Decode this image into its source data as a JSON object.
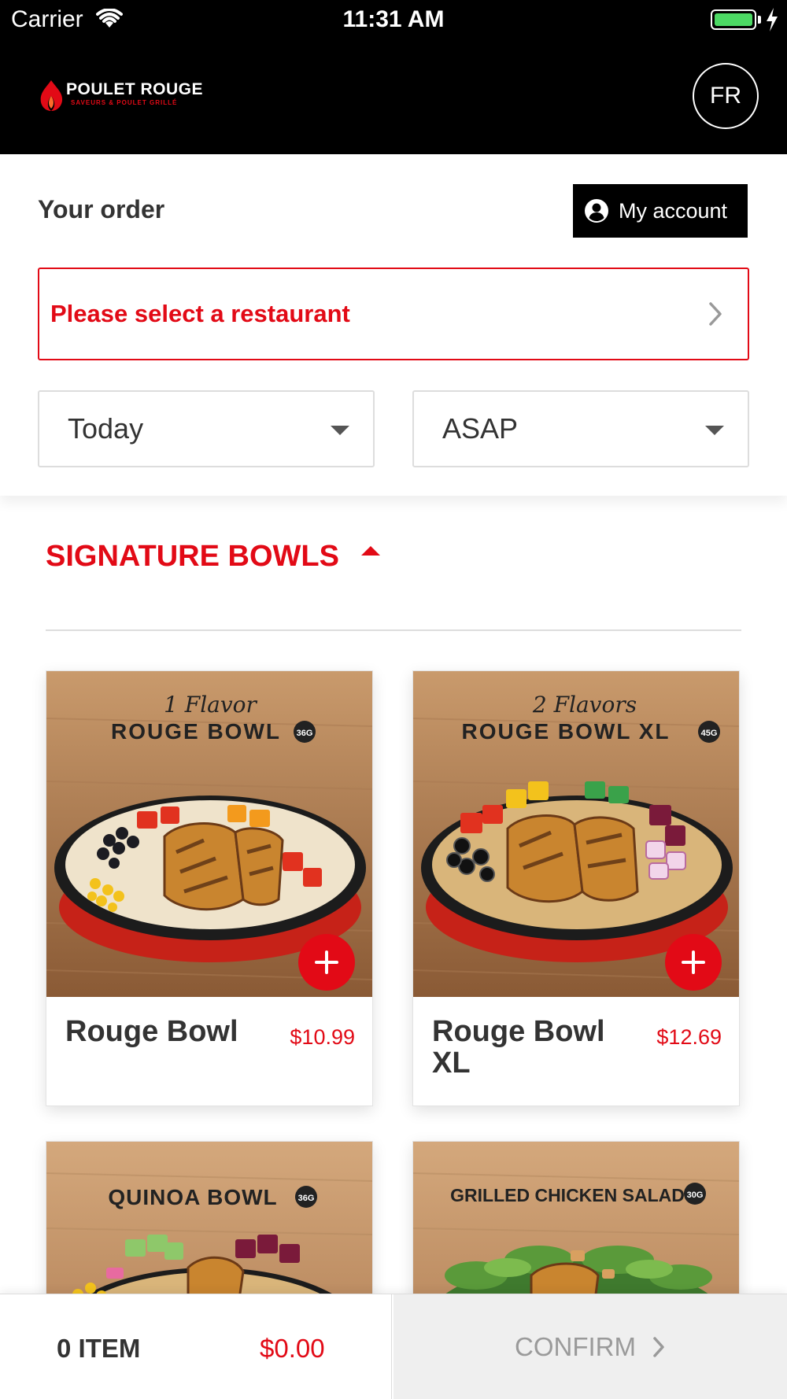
{
  "status_bar": {
    "carrier": "Carrier",
    "time": "11:31 AM"
  },
  "header": {
    "brand_name": "POULET ROUGE",
    "brand_tagline": "SAVEURS & POULET GRILLÉ",
    "language_button": "FR"
  },
  "order": {
    "title": "Your order",
    "account_button": "My account",
    "restaurant_prompt": "Please select a restaurant",
    "day_select": "Today",
    "time_select": "ASAP"
  },
  "menu": {
    "section_title": "SIGNATURE BOWLS",
    "items": [
      {
        "name": "Rouge Bowl",
        "price": "$10.99",
        "image_line1": "1 Flavor",
        "image_line2": "ROUGE BOWL",
        "protein": "36G"
      },
      {
        "name": "Rouge Bowl XL",
        "price": "$12.69",
        "image_line1": "2 Flavors",
        "image_line2": "ROUGE BOWL XL",
        "protein": "45G"
      },
      {
        "name": "",
        "price": "",
        "image_line1": "",
        "image_line2": "QUINOA BOWL",
        "protein": "36G"
      },
      {
        "name": "",
        "price": "",
        "image_line1": "",
        "image_line2": "GRILLED CHICKEN SALAD",
        "protein": "30G"
      }
    ]
  },
  "cart": {
    "item_count": "0 ITEM",
    "total": "$0.00",
    "confirm_label": "CONFIRM"
  },
  "colors": {
    "brand_red": "#e20a16",
    "header_black": "#000000",
    "confirm_disabled_bg": "#efefef"
  }
}
